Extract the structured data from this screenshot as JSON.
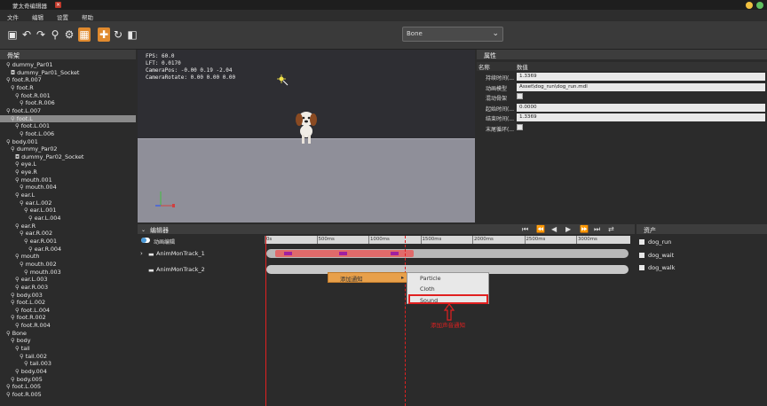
{
  "window": {
    "title": "蒙太奇编辑器",
    "close_glyph": "×"
  },
  "menu": {
    "items": [
      "文件",
      "编辑",
      "设置",
      "帮助"
    ]
  },
  "toolbar": {
    "dropdown_value": "Bone"
  },
  "scene_panel": {
    "title": "骨架",
    "tree": [
      {
        "label": "dummy_Par01",
        "indent": 1,
        "kind": "bone"
      },
      {
        "label": "dummy_Par01_Socket",
        "indent": 2,
        "kind": "socket"
      },
      {
        "label": "foot.R.007",
        "indent": 1,
        "kind": "bone"
      },
      {
        "label": "foot.R",
        "indent": 2,
        "kind": "bone"
      },
      {
        "label": "foot.R.001",
        "indent": 3,
        "kind": "bone"
      },
      {
        "label": "foot.R.006",
        "indent": 4,
        "kind": "bone"
      },
      {
        "label": "foot.L.007",
        "indent": 1,
        "kind": "bone"
      },
      {
        "label": "foot.L",
        "indent": 2,
        "kind": "bone",
        "selected": true
      },
      {
        "label": "foot.L.001",
        "indent": 3,
        "kind": "bone"
      },
      {
        "label": "foot.L.006",
        "indent": 4,
        "kind": "bone"
      },
      {
        "label": "body.001",
        "indent": 1,
        "kind": "bone"
      },
      {
        "label": "dummy_Par02",
        "indent": 2,
        "kind": "bone"
      },
      {
        "label": "dummy_Par02_Socket",
        "indent": 3,
        "kind": "socket"
      },
      {
        "label": "eye.L",
        "indent": 3,
        "kind": "bone"
      },
      {
        "label": "eye.R",
        "indent": 3,
        "kind": "bone"
      },
      {
        "label": "mouth.001",
        "indent": 3,
        "kind": "bone"
      },
      {
        "label": "mouth.004",
        "indent": 4,
        "kind": "bone"
      },
      {
        "label": "ear.L",
        "indent": 3,
        "kind": "bone"
      },
      {
        "label": "ear.L.002",
        "indent": 4,
        "kind": "bone"
      },
      {
        "label": "ear.L.001",
        "indent": 5,
        "kind": "bone"
      },
      {
        "label": "ear.L.004",
        "indent": 6,
        "kind": "bone"
      },
      {
        "label": "ear.R",
        "indent": 3,
        "kind": "bone"
      },
      {
        "label": "ear.R.002",
        "indent": 4,
        "kind": "bone"
      },
      {
        "label": "ear.R.001",
        "indent": 5,
        "kind": "bone"
      },
      {
        "label": "ear.R.004",
        "indent": 6,
        "kind": "bone"
      },
      {
        "label": "mouth",
        "indent": 3,
        "kind": "bone"
      },
      {
        "label": "mouth.002",
        "indent": 4,
        "kind": "bone"
      },
      {
        "label": "mouth.003",
        "indent": 5,
        "kind": "bone"
      },
      {
        "label": "ear.L.003",
        "indent": 3,
        "kind": "bone"
      },
      {
        "label": "ear.R.003",
        "indent": 3,
        "kind": "bone"
      },
      {
        "label": "body.003",
        "indent": 2,
        "kind": "bone"
      },
      {
        "label": "foot.L.002",
        "indent": 2,
        "kind": "bone"
      },
      {
        "label": "foot.L.004",
        "indent": 3,
        "kind": "bone"
      },
      {
        "label": "foot.R.002",
        "indent": 2,
        "kind": "bone"
      },
      {
        "label": "foot.R.004",
        "indent": 3,
        "kind": "bone"
      },
      {
        "label": "Bone",
        "indent": 1,
        "kind": "bone"
      },
      {
        "label": "body",
        "indent": 2,
        "kind": "bone"
      },
      {
        "label": "tail",
        "indent": 3,
        "kind": "bone"
      },
      {
        "label": "tail.002",
        "indent": 4,
        "kind": "bone"
      },
      {
        "label": "tail.003",
        "indent": 5,
        "kind": "bone"
      },
      {
        "label": "body.004",
        "indent": 3,
        "kind": "bone"
      },
      {
        "label": "body.005",
        "indent": 2,
        "kind": "bone"
      },
      {
        "label": "foot.L.005",
        "indent": 1,
        "kind": "bone"
      },
      {
        "label": "foot.R.005",
        "indent": 1,
        "kind": "bone"
      }
    ]
  },
  "viewport": {
    "fps_line": "FPS: 60.0",
    "lft_line": "LFT: 0.0170",
    "campos_line": "CameraPos: -0.00 0.19 -2.04",
    "camrot_line": "CameraRotate: 0.00 0.00 0.00"
  },
  "properties": {
    "title": "属性",
    "col_name": "名称",
    "col_value": "数值",
    "rows": [
      {
        "name": "持续时间(...",
        "value": "1.3369",
        "type": "spin"
      },
      {
        "name": "动画模型",
        "value": "Asset\\dog_run\\dog_run.mdl",
        "type": "text"
      },
      {
        "name": "混动骨架",
        "value": "",
        "type": "check"
      },
      {
        "name": "起始时间(...",
        "value": "0.0000",
        "type": "spin"
      },
      {
        "name": "结束时间(...",
        "value": "1.3369",
        "type": "spin"
      },
      {
        "name": "末尾循环(...",
        "value": "",
        "type": "check"
      }
    ]
  },
  "editor": {
    "title": "编辑器",
    "anim_label": "动画编辑",
    "track1": "AnimMonTrack_1",
    "track2": "AnimMonTrack_2",
    "ruler_ticks": [
      "0s",
      "500ms",
      "1000ms",
      "1500ms",
      "2000ms",
      "2500ms",
      "3000ms"
    ],
    "context_menu": {
      "add_notify": "添加通知",
      "items": [
        "Particle",
        "Cloth",
        "Sound"
      ]
    },
    "annotation": "添加声音通知"
  },
  "assets": {
    "title": "资产",
    "items": [
      "dog_run",
      "dog_wait",
      "dog_walk"
    ]
  },
  "colors": {
    "accent": "#e08a2e",
    "highlight": "#e02020",
    "clip_red": "#e06a6a"
  }
}
